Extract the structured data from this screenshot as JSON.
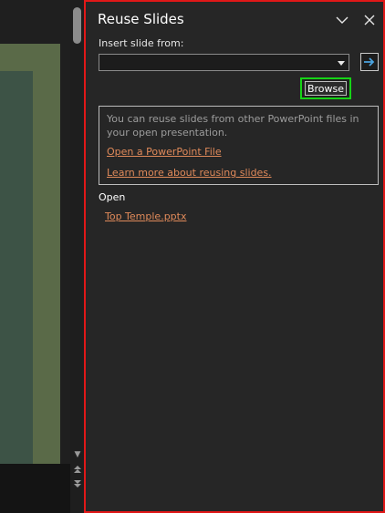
{
  "pane": {
    "title": "Reuse Slides",
    "insert_label": "Insert slide from:",
    "source_value": "",
    "browse_label": "Browse",
    "info_text": "You can reuse slides from other PowerPoint files in your open presentation.",
    "open_file_link": "Open a PowerPoint File",
    "learn_more_link": "Learn more about reusing slides.",
    "open_section_label": "Open",
    "open_files": [
      "Top Temple.pptx"
    ]
  },
  "icons": {
    "collapse": "chevron-down-icon",
    "close": "close-icon",
    "go": "arrow-right-icon",
    "scroll_down": "scroll-down-arrow-icon",
    "prev_slide": "double-up-arrow-icon",
    "next_slide": "double-down-arrow-icon"
  },
  "colors": {
    "pane_bg": "#262626",
    "highlight_red": "#e01818",
    "highlight_green": "#16d416",
    "link": "#e08a5a",
    "slide_outer": "#5a6a48",
    "slide_inner": "#3d5346"
  }
}
